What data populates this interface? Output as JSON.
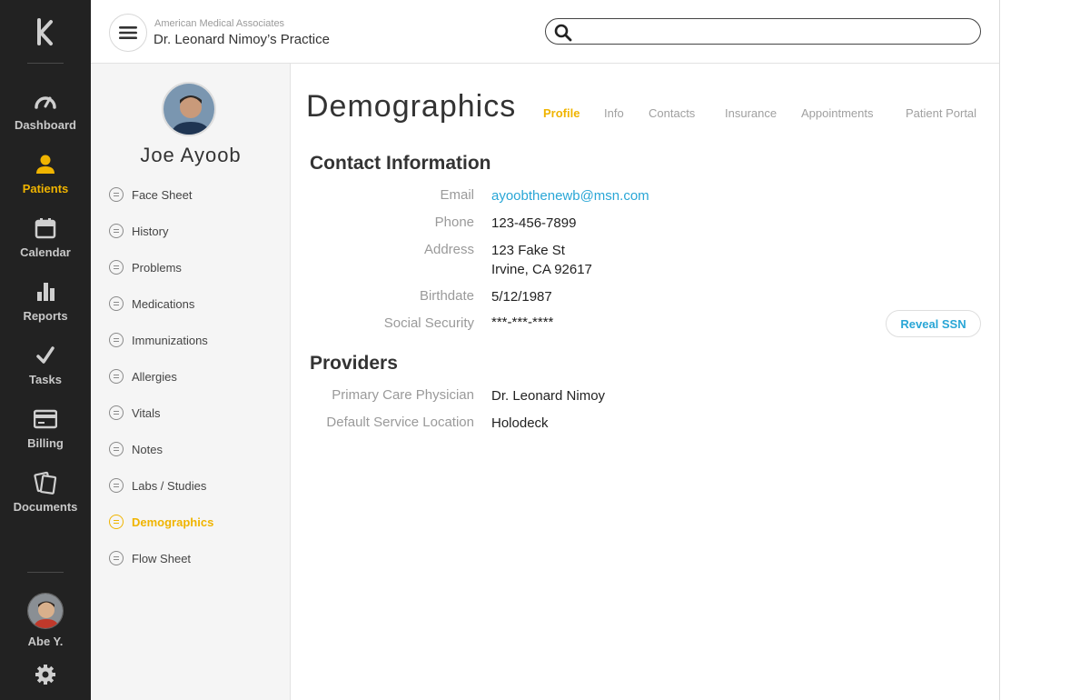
{
  "rail": {
    "items": [
      {
        "label": "Dashboard",
        "icon": "gauge-icon"
      },
      {
        "label": "Patients",
        "icon": "person-icon"
      },
      {
        "label": "Calendar",
        "icon": "calendar-icon"
      },
      {
        "label": "Reports",
        "icon": "bar-chart-icon"
      },
      {
        "label": "Tasks",
        "icon": "checkmark-icon"
      },
      {
        "label": "Billing",
        "icon": "credit-card-icon"
      },
      {
        "label": "Documents",
        "icon": "documents-icon"
      }
    ],
    "active": "Patients",
    "user_name": "Abe Y."
  },
  "header": {
    "org": "American Medical Associates",
    "practice": "Dr. Leonard Nimoy’s Practice",
    "search_value": ""
  },
  "patient": {
    "name": "Joe Ayoob",
    "nav": [
      "Face Sheet",
      "History",
      "Problems",
      "Medications",
      "Immunizations",
      "Allergies",
      "Vitals",
      "Notes",
      "Labs / Studies",
      "Demographics",
      "Flow Sheet"
    ],
    "active_nav": "Demographics"
  },
  "main": {
    "title": "Demographics",
    "tabs": [
      "Profile",
      "Info",
      "Contacts",
      "Insurance",
      "Appointments",
      "Patient Portal"
    ],
    "active_tab": "Profile",
    "contact": {
      "title": "Contact Information",
      "email_label": "Email",
      "email": "ayoobthenewb@msn.com",
      "phone_label": "Phone",
      "phone": "123-456-7899",
      "address_label": "Address",
      "address_line1": "123 Fake St",
      "address_line2": "Irvine, CA 92617",
      "birthdate_label": "Birthdate",
      "birthdate": "5/12/1987",
      "ssn_label": "Social Security",
      "ssn": "***-***-****",
      "reveal_label": "Reveal SSN"
    },
    "providers": {
      "title": "Providers",
      "pcp_label": "Primary Care Physician",
      "pcp": "Dr. Leonard Nimoy",
      "location_label": "Default Service Location",
      "location": "Holodeck"
    }
  },
  "colors": {
    "accent": "#f0b400",
    "link": "#29a6d6",
    "rail": "#222222"
  }
}
